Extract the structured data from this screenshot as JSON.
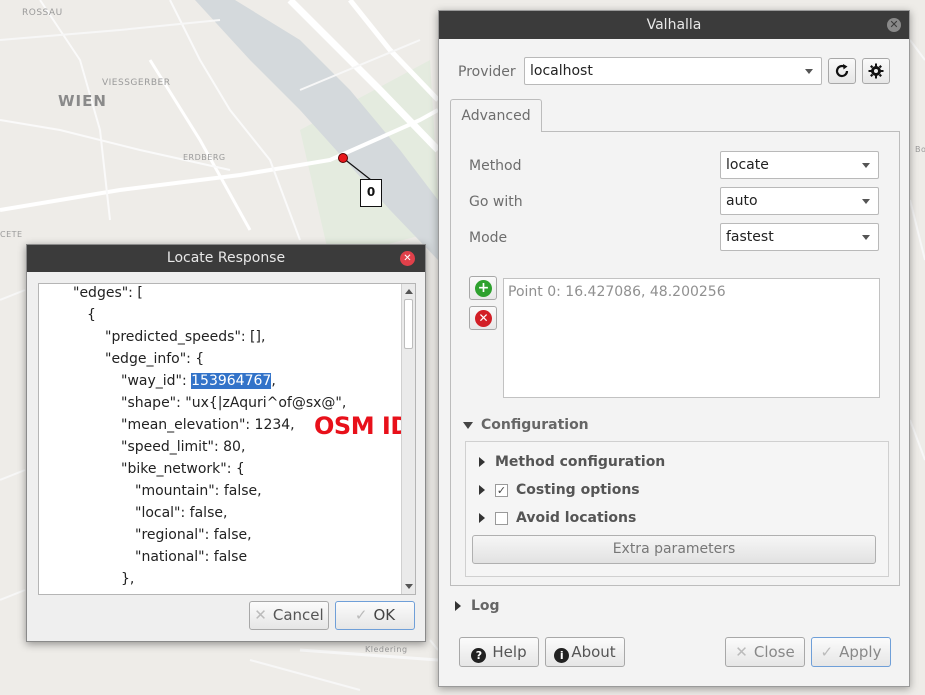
{
  "map": {
    "labels": {
      "rossau": "ROSSAU",
      "wien": "WIEN",
      "vies": "VIESSGERBER",
      "erdberg": "ERDBERG",
      "cete": "CETE",
      "kledering": "Kledering",
      "bo": "Bo"
    },
    "marker_label": "0"
  },
  "valhalla": {
    "title": "Valhalla",
    "provider_label": "Provider",
    "provider_value": "localhost",
    "tab_advanced": "Advanced",
    "method_label": "Method",
    "method_value": "locate",
    "gowith_label": "Go with",
    "gowith_value": "auto",
    "mode_label": "Mode",
    "mode_value": "fastest",
    "point0": "Point 0: 16.427086, 48.200256",
    "configuration": "Configuration",
    "method_configuration": "Method configuration",
    "costing_options": "Costing options",
    "avoid_locations": "Avoid locations",
    "extra_parameters": "Extra parameters",
    "log": "Log",
    "help": "Help",
    "about": "About",
    "close": "Close",
    "apply": "Apply",
    "colors": {
      "titlebar": "#3b3b3b",
      "add": "#2ea12e",
      "remove": "#d21f26",
      "apply_border": "#6f9fd8"
    }
  },
  "locate": {
    "title": "Locate Response",
    "json_lines": [
      "\"edges\": [",
      "{",
      "\"predicted_speeds\": [],",
      "\"edge_info\": {",
      "\"shape\": \"ux{|zAquri^of@sx@\",",
      "\"mean_elevation\": 1234,",
      "\"speed_limit\": 80,",
      "\"bike_network\": {",
      "\"mountain\": false,",
      "\"local\": false,",
      "\"regional\": false,",
      "\"national\": false",
      "},"
    ],
    "way_id_key": "\"way_id\": ",
    "way_id_value": "153964767",
    "way_id_comma": ",",
    "annotation": "OSM ID",
    "cancel": "Cancel",
    "ok": "OK",
    "colors": {
      "highlight": "#3273c9",
      "annotation": "#e8101a"
    }
  }
}
